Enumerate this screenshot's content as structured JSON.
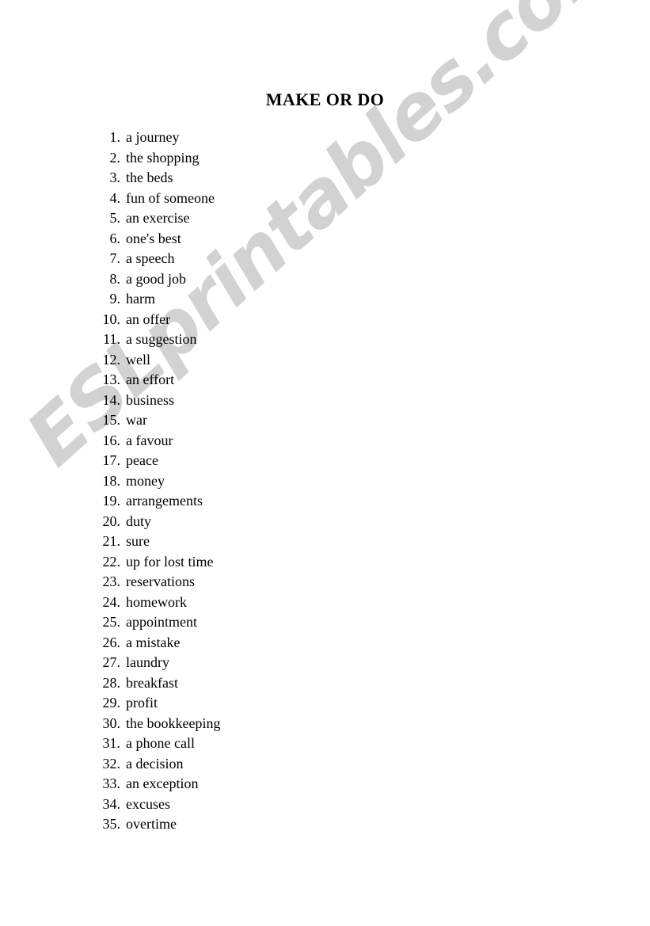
{
  "document": {
    "title": "MAKE OR DO",
    "background_color": "#ffffff",
    "text_color": "#000000"
  },
  "watermark": {
    "text": "ESLprintables.com",
    "color": "#d2d2d2",
    "rotation_degrees": -42
  },
  "list": {
    "items": [
      {
        "number": "1.",
        "text": "a journey"
      },
      {
        "number": "2.",
        "text": "the shopping"
      },
      {
        "number": "3.",
        "text": "the beds"
      },
      {
        "number": "4.",
        "text": "fun of someone"
      },
      {
        "number": "5.",
        "text": "an exercise"
      },
      {
        "number": "6.",
        "text": "one's best"
      },
      {
        "number": "7.",
        "text": "a speech"
      },
      {
        "number": "8.",
        "text": "a good job"
      },
      {
        "number": "9.",
        "text": "harm"
      },
      {
        "number": "10.",
        "text": "an offer"
      },
      {
        "number": "11.",
        "text": "a suggestion"
      },
      {
        "number": "12.",
        "text": "well"
      },
      {
        "number": "13.",
        "text": "an effort"
      },
      {
        "number": "14.",
        "text": "business"
      },
      {
        "number": "15.",
        "text": "war"
      },
      {
        "number": "16.",
        "text": "a favour"
      },
      {
        "number": "17.",
        "text": "peace"
      },
      {
        "number": "18.",
        "text": "money"
      },
      {
        "number": "19.",
        "text": "arrangements"
      },
      {
        "number": "20.",
        "text": "duty"
      },
      {
        "number": "21.",
        "text": "sure"
      },
      {
        "number": "22.",
        "text": "up for lost time"
      },
      {
        "number": "23.",
        "text": "reservations"
      },
      {
        "number": "24.",
        "text": "homework"
      },
      {
        "number": "25.",
        "text": "appointment"
      },
      {
        "number": "26.",
        "text": "a mistake"
      },
      {
        "number": "27.",
        "text": "laundry"
      },
      {
        "number": "28.",
        "text": "breakfast"
      },
      {
        "number": "29.",
        "text": "profit"
      },
      {
        "number": "30.",
        "text": "the bookkeeping"
      },
      {
        "number": "31.",
        "text": "a phone call"
      },
      {
        "number": "32.",
        "text": "a decision"
      },
      {
        "number": "33.",
        "text": "an exception"
      },
      {
        "number": "34.",
        "text": "excuses"
      },
      {
        "number": "35.",
        "text": "overtime"
      }
    ]
  }
}
